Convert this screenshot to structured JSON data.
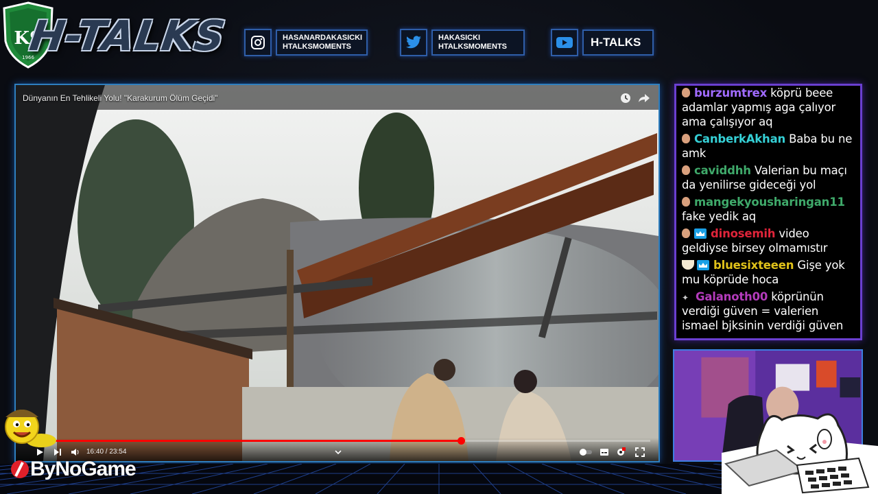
{
  "header": {
    "club_badge": {
      "letters": "KS",
      "year": "1966",
      "colors": {
        "primary": "#1f8a3a",
        "secondary": "#ffffff"
      }
    },
    "brand": "H-TALKS",
    "socials": [
      {
        "icon": "instagram-icon",
        "line1": "HASANARDAKASICKI",
        "line2": "HTALKSMOMENTS"
      },
      {
        "icon": "twitter-icon",
        "line1": "HAKASICKI",
        "line2": "HTALKSMOMENTS"
      },
      {
        "icon": "youtube-icon",
        "line1": "H-TALKS"
      }
    ]
  },
  "video": {
    "title": "Dünyanın En Tehlikeli Yolu! \"Karakurum Ölüm Geçidi\"",
    "time_label": "16:40 / 23:54",
    "progress": 0.698
  },
  "chat": {
    "messages": [
      {
        "badges": [
          "egg"
        ],
        "user": "burzumtrex",
        "color": "#a06bff",
        "text": "köprü beee adamlar yapmış aga çalıyor ama çalışıyor aq"
      },
      {
        "badges": [
          "egg"
        ],
        "user": "CanberkAkhan",
        "color": "#35d0d6",
        "text": "Baba bu ne amk"
      },
      {
        "badges": [
          "egg"
        ],
        "user": "caviddhh",
        "color": "#3fa96a",
        "text": "Valerian bu maçı da yenilirse gideceği yol"
      },
      {
        "badges": [
          "egg"
        ],
        "user": "mangekyousharingan11",
        "color": "#3fa96a",
        "text": "fake yedik aq"
      },
      {
        "badges": [
          "egg",
          "crown"
        ],
        "user": "dinosemih",
        "color": "#e0243a",
        "text": "video geldiyse birsey olmamıstır"
      },
      {
        "badges": [
          "bowl",
          "crown"
        ],
        "user": "bluesixteeen",
        "color": "#e0c21a",
        "text": "Gişe yok mu köprüde hoca"
      },
      {
        "badges": [
          "star"
        ],
        "user": "Galanoth00",
        "color": "#b33bbb",
        "text": "köprünün verdiği güven = valerien ismael bjksinin verdiği güven"
      }
    ]
  },
  "sponsor": {
    "text": "ByNoGame"
  },
  "colors": {
    "accent_blue": "#2e7fbf",
    "chat_border": "#6a3fd0",
    "progress": "#ff0000"
  }
}
